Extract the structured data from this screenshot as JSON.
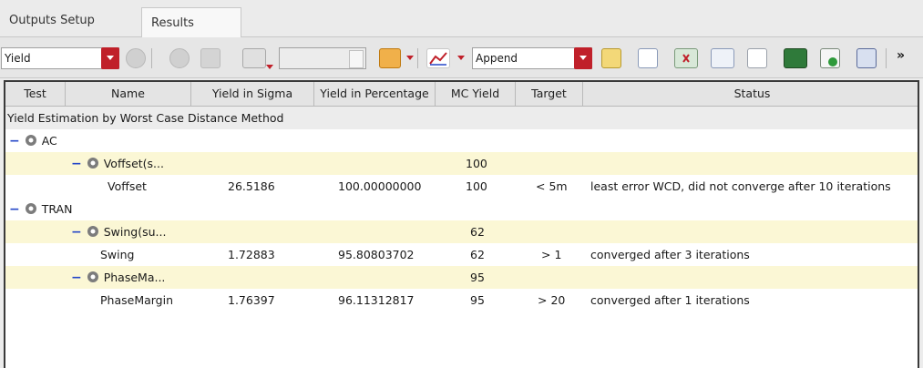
{
  "tabs": [
    {
      "label": "Outputs Setup",
      "active": false
    },
    {
      "label": "Results",
      "active": true
    }
  ],
  "toolbar": {
    "yield_select": "Yield",
    "append_select": "Append",
    "more": "»"
  },
  "table": {
    "columns": [
      "Test",
      "Name",
      "Yield in Sigma",
      "Yield in Percentage",
      "MC Yield",
      "Target",
      "Status"
    ],
    "section_title": "Yield Estimation by Worst Case Distance Method",
    "groups": [
      {
        "test": "AC",
        "items": [
          {
            "summary_name": "Voffset(s...",
            "summary_mc": "100",
            "name": "Voffset",
            "sigma": "26.5186",
            "percentage": "100.00000000",
            "mc": "100",
            "target": "< 5m",
            "status": "least error WCD, did not converge after 10 iterations"
          }
        ]
      },
      {
        "test": "TRAN",
        "items": [
          {
            "summary_name": "Swing(su...",
            "summary_mc": "62",
            "name": "Swing",
            "sigma": "1.72883",
            "percentage": "95.80803702",
            "mc": "62",
            "target": "> 1",
            "status": "converged after 3 iterations"
          },
          {
            "summary_name": "PhaseMa...",
            "summary_mc": "95",
            "name": "PhaseMargin",
            "sigma": "1.76397",
            "percentage": "96.11312817",
            "mc": "95",
            "target": "> 20",
            "status": "converged after 1 iterations"
          }
        ]
      }
    ]
  },
  "colors": {
    "accent_red": "#c0202a",
    "highlight_row": "#fbf7d5",
    "tree_minus": "#2547c8"
  }
}
